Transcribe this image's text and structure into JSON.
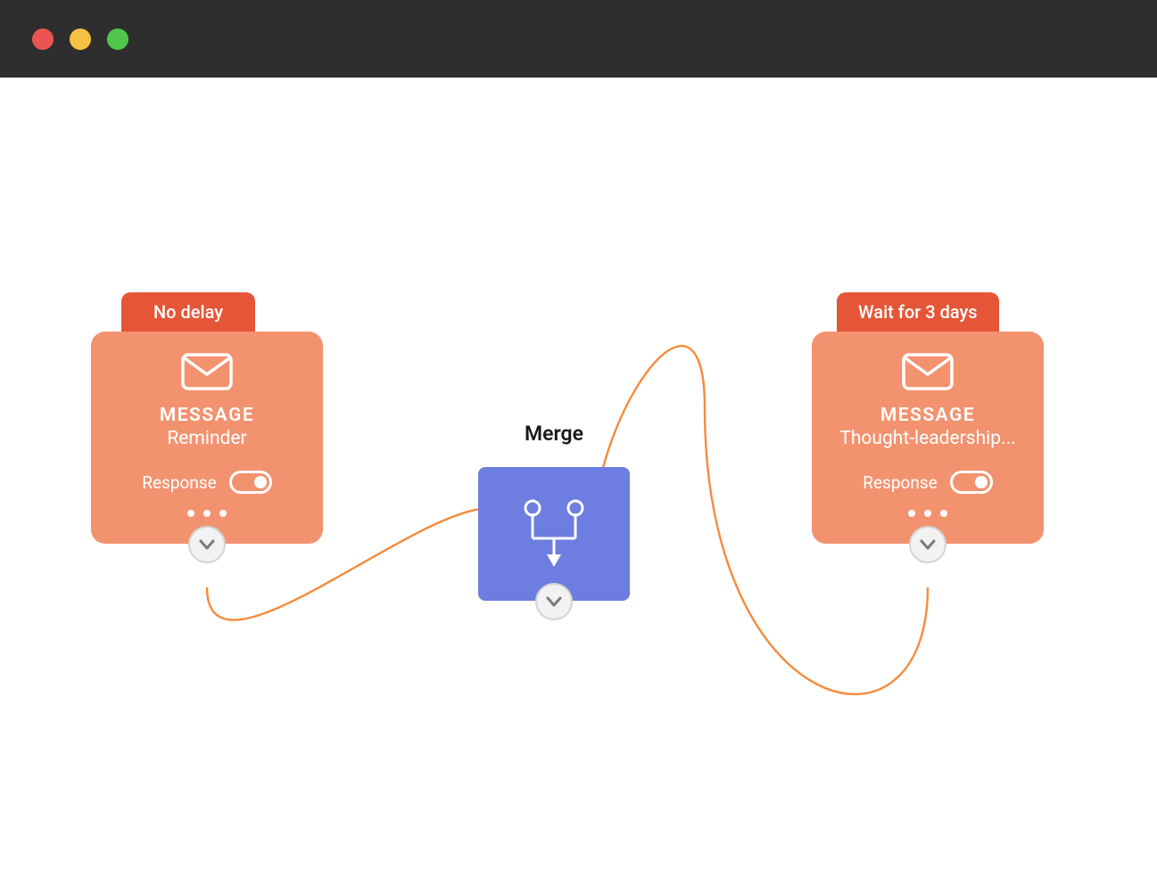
{
  "nodes": {
    "left": {
      "delay_label": "No delay",
      "type_label": "MESSAGE",
      "title": "Reminder",
      "response_label": "Response"
    },
    "right": {
      "delay_label": "Wait for 3 days",
      "type_label": "MESSAGE",
      "title": "Thought-leadership...",
      "response_label": "Response"
    },
    "merge": {
      "label": "Merge"
    }
  }
}
